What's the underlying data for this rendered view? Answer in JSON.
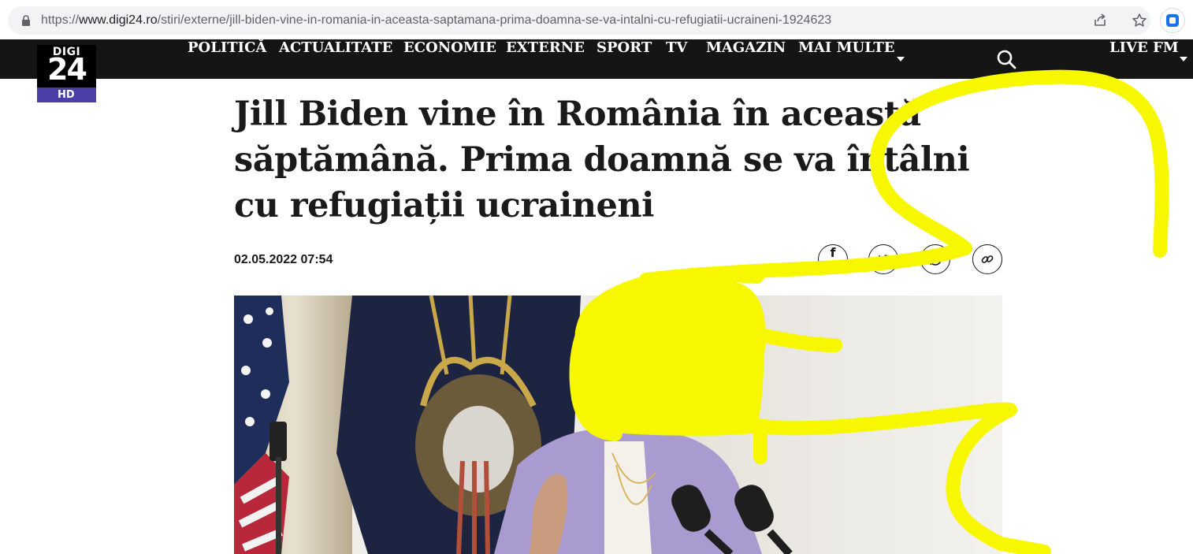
{
  "browser": {
    "url_prefix": "https://",
    "url_host": "www.digi24.ro",
    "url_path": "/stiri/externe/jill-biden-vine-in-romania-in-aceasta-saptamana-prima-doamna-se-va-intalni-cu-refugiatii-ucraineni-1924623",
    "icons": [
      "lock-icon",
      "share-icon",
      "star-icon",
      "extension-icon"
    ]
  },
  "site": {
    "logo": {
      "line1": "DIGI",
      "line2": "24",
      "badge": "HD"
    },
    "nav": [
      {
        "label": "POLITICĂ"
      },
      {
        "label": "ACTUALITATE"
      },
      {
        "label": "ECONOMIE"
      },
      {
        "label": "EXTERNE"
      },
      {
        "label": "SPORT"
      },
      {
        "label": "TV"
      },
      {
        "label": "MAGAZIN"
      },
      {
        "label": "MAI MULTE"
      }
    ],
    "live": "LIVE FM",
    "colors": {
      "navbar": "#151515",
      "logo_badge": "#4a3fa6",
      "scribble": "#f7f700"
    }
  },
  "article": {
    "headline": "Jill Biden vine în România în această săptămână. Prima doamnă se va întâlni cu refugiații ucraineni",
    "date": "02.05.2022 07:54",
    "share": {
      "facebook": "f",
      "twitter_icon": "twitter-icon",
      "whatsapp_icon": "whatsapp-icon",
      "link_icon": "link-icon"
    }
  }
}
